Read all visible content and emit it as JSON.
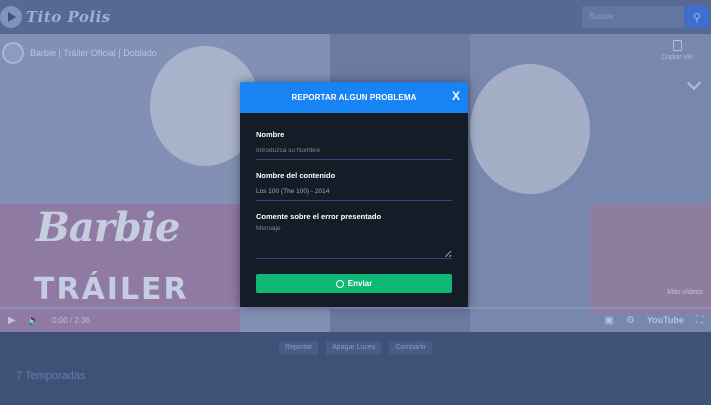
{
  "site": {
    "logo_text": "Tito Polis",
    "search_placeholder": "Buscar",
    "search_icon": "search-icon"
  },
  "video": {
    "title": "Barbie | Tráiler Oficial | Doblado",
    "copy_label": "Copiar vín",
    "brand_word": "Barbie",
    "trailer_word": "TRÁILER",
    "time": "0:00 / 2:36",
    "youtube_label": "YouTube",
    "more_label": "Más vídeos"
  },
  "actions": [
    "Reportar",
    "Apagar Luces",
    "Compartir"
  ],
  "seasons_label": "7 Temporadas",
  "modal": {
    "title": "REPORTAR ALGUN PROBLEMA",
    "close_label": "X",
    "name_label": "Nombre",
    "name_placeholder": "Introduzca su Nombre",
    "content_label": "Nombre del contenido",
    "content_value": "Los 100 (The 100) - 2014",
    "comment_label": "Comente sobre el error presentado",
    "comment_placeholder": "Mensaje",
    "send_label": "Enviar",
    "colors": {
      "header": "#1883f2",
      "send_button": "#10b876",
      "body": "#131c27"
    }
  }
}
